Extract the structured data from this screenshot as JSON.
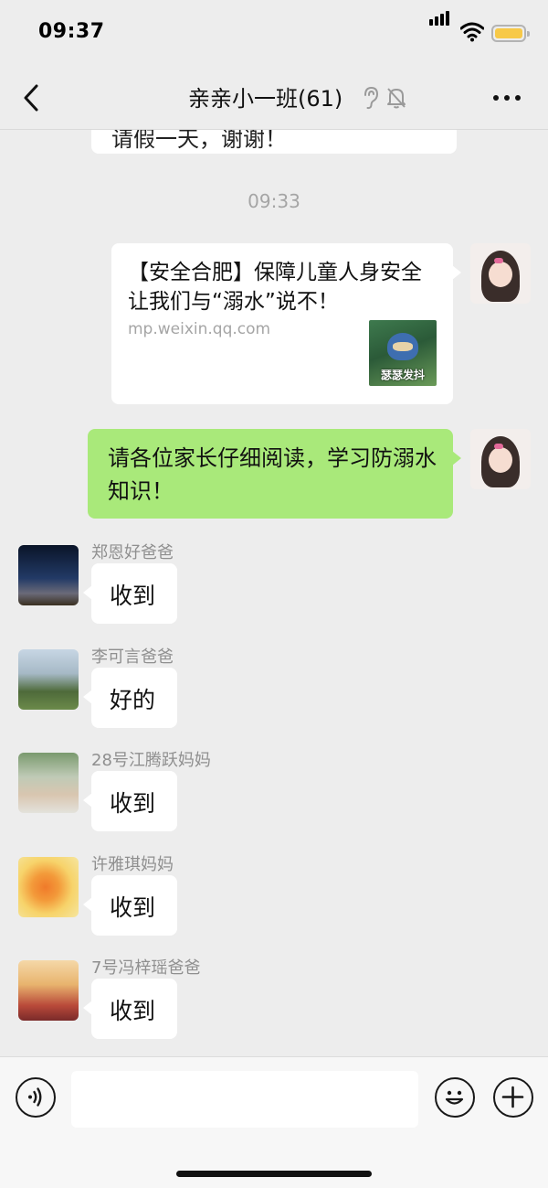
{
  "status_bar": {
    "time": "09:37"
  },
  "nav": {
    "title": "亲亲小一班(61)"
  },
  "chat": {
    "prev_text": "请假一天，谢谢！",
    "timestamp": "09:33",
    "link_card": {
      "title": "【安全合肥】保障儿童人身安全 让我们与“溺水”说不！",
      "domain": "mp.weixin.qq.com",
      "thumb_caption": "瑟瑟发抖"
    },
    "my_message": "请各位家长仔细阅读，学习防溺水知识！",
    "replies": [
      {
        "sender": "郑恩好爸爸",
        "text": "收到"
      },
      {
        "sender": "李可言爸爸",
        "text": "好的"
      },
      {
        "sender": "28号江腾跃妈妈",
        "text": "收到"
      },
      {
        "sender": "许雅琪妈妈",
        "text": "收到"
      },
      {
        "sender": "7号冯梓瑶爸爸",
        "text": "收到"
      }
    ]
  },
  "input": {
    "value": ""
  }
}
